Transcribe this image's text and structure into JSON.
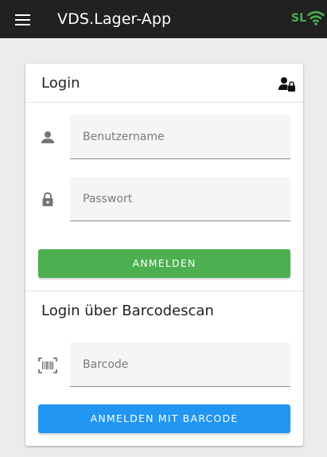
{
  "appbar": {
    "title": "VDS.Lager-App",
    "status_text": "SL",
    "menu_icon": "hamburger-menu-icon",
    "wifi_icon": "wifi-icon"
  },
  "login_card": {
    "title": "Login",
    "title_icon": "user-lock-icon",
    "username": {
      "placeholder": "Benutzername",
      "value": "",
      "icon": "person-icon"
    },
    "password": {
      "placeholder": "Passwort",
      "value": "",
      "icon": "lock-icon"
    },
    "login_button": "ANMELDEN",
    "barcode_section_title": "Login über Barcodescan",
    "barcode": {
      "placeholder": "Barcode",
      "value": "",
      "icon": "barcode-scan-icon"
    },
    "barcode_button": "ANMELDEN MIT BARCODE"
  },
  "colors": {
    "appbar": "#212121",
    "status": "#4caf50",
    "login_button": "#4caf50",
    "barcode_button": "#2196f3"
  }
}
